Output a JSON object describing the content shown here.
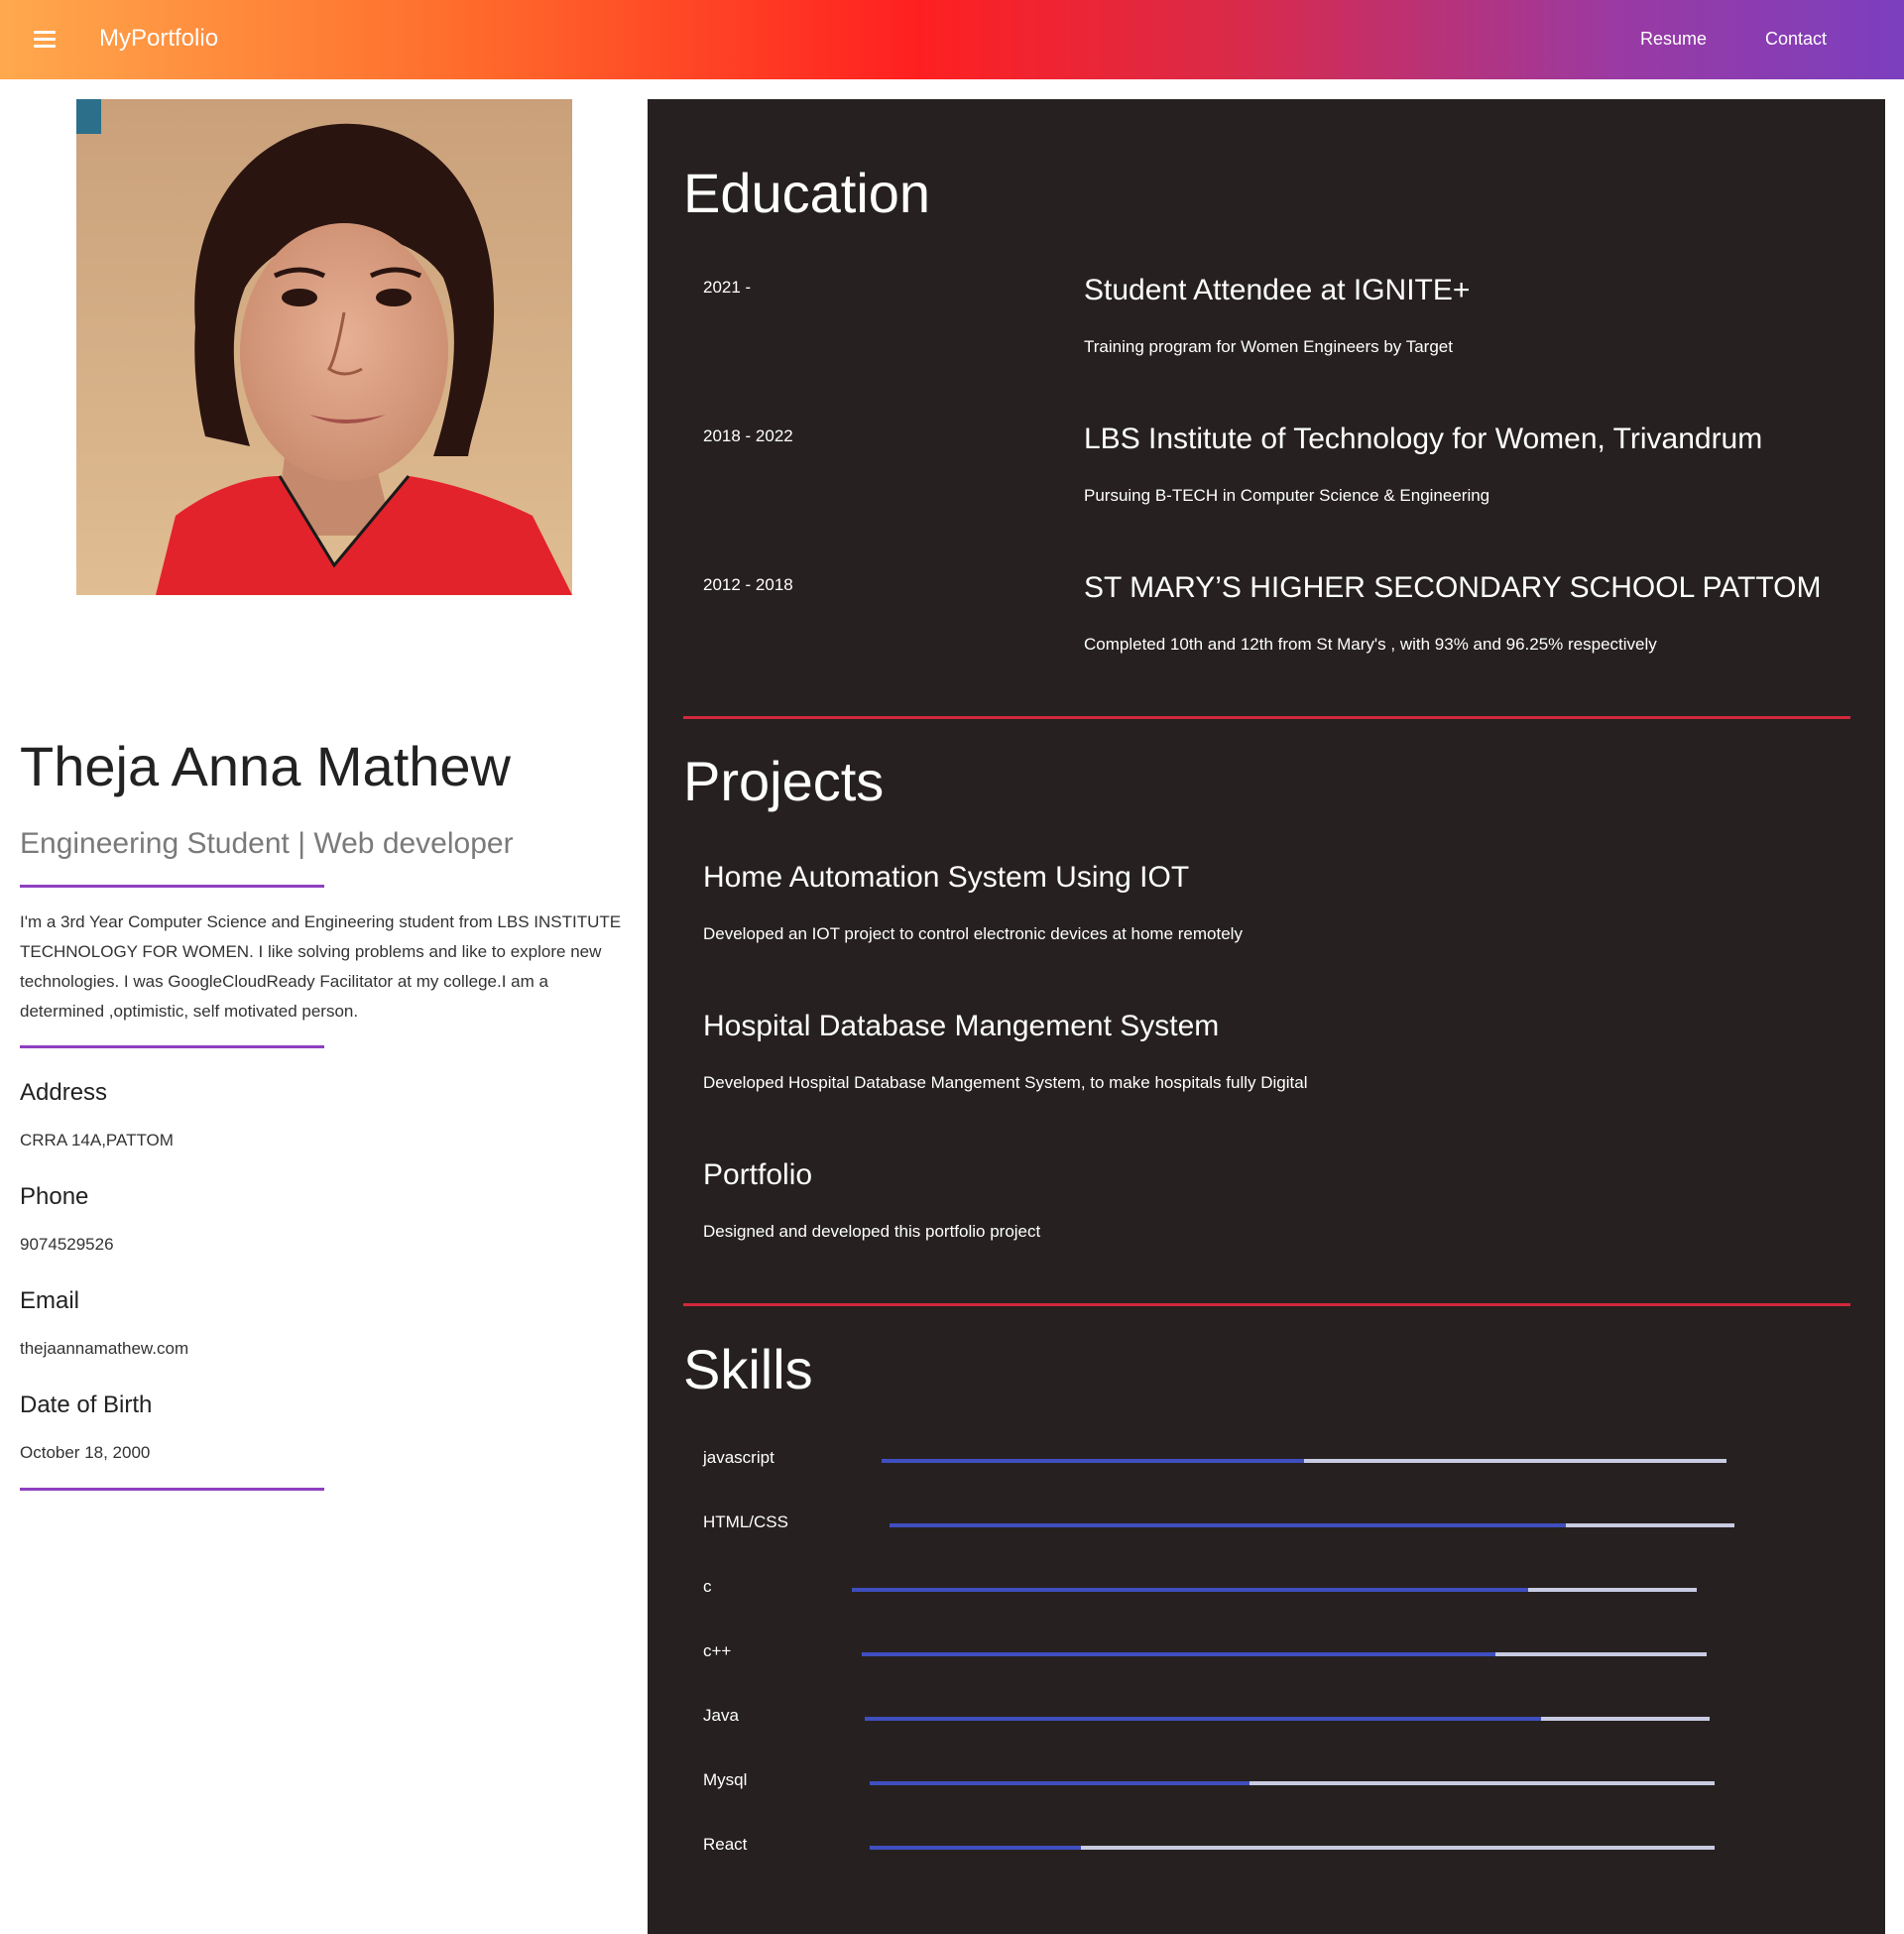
{
  "header": {
    "brand": "MyPortfolio",
    "nav": [
      "Resume",
      "Contact"
    ],
    "gradient": [
      "#ffa94d",
      "#ff2020",
      "#7b3fbf"
    ]
  },
  "profile": {
    "name": "Theja Anna Mathew",
    "role": "Engineering Student | Web developer",
    "about": "I'm a 3rd Year Computer Science and Engineering student from LBS INSTITUTE TECHNOLOGY FOR WOMEN. I like solving problems and like to explore new technologies. I was GoogleCloudReady Facilitator at my college.I am a determined ,optimistic, self motivated person.",
    "fields": [
      {
        "label": "Address",
        "value": "CRRA 14A,PATTOM"
      },
      {
        "label": "Phone",
        "value": "9074529526"
      },
      {
        "label": "Email",
        "value": "thejaannamathew.com"
      },
      {
        "label": "Date of Birth",
        "value": "October 18, 2000"
      }
    ],
    "accent": "#8e3fbf"
  },
  "education": {
    "title": "Education",
    "items": [
      {
        "years": "2021 -",
        "title": "Student Attendee at IGNITE+",
        "desc": "Training program for Women Engineers by Target"
      },
      {
        "years": "2018 - 2022",
        "title": "LBS Institute of Technology for Women, Trivandrum",
        "desc": "Pursuing B-TECH in Computer Science & Engineering"
      },
      {
        "years": "2012 - 2018",
        "title": "ST MARY’S HIGHER SECONDARY SCHOOL PATTOM",
        "desc": "Completed 10th and 12th from St Mary's , with 93% and 96.25% respectively"
      }
    ]
  },
  "projects": {
    "title": "Projects",
    "items": [
      {
        "title": "Home Automation System Using IOT",
        "desc": "Developed an IOT project to control electronic devices at home remotely"
      },
      {
        "title": "Hospital Database Mangement System",
        "desc": "Developed Hospital Database Mangement System, to make hospitals fully Digital"
      },
      {
        "title": "Portfolio",
        "desc": "Designed and developed this portfolio project"
      }
    ]
  },
  "skills": {
    "title": "Skills",
    "fill_color": "#3f4fbf",
    "track_color": "#c9cbe3",
    "items": [
      {
        "name": "javascript",
        "level": 0.5
      },
      {
        "name": "HTML/CSS",
        "level": 0.8
      },
      {
        "name": "c",
        "level": 0.8
      },
      {
        "name": "c++",
        "level": 0.75
      },
      {
        "name": "Java",
        "level": 0.8
      },
      {
        "name": "Mysql",
        "level": 0.45
      },
      {
        "name": "React",
        "level": 0.25
      }
    ]
  }
}
